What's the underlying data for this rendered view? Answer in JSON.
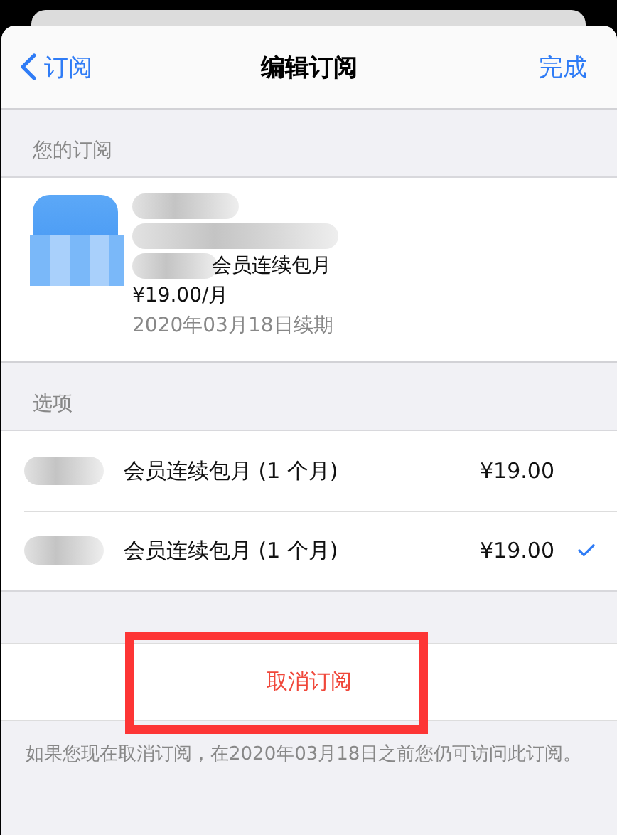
{
  "nav": {
    "back": "订阅",
    "title": "编辑订阅",
    "done": "完成"
  },
  "subscription": {
    "header": "您的订阅",
    "redacted": true,
    "plan": "会员连续包月",
    "price": "¥19.00/月",
    "renewal": "2020年03月18日续期"
  },
  "options": {
    "header": "选项",
    "items": [
      {
        "label": "会员连续包月 (1 个月)",
        "price": "¥19.00",
        "selected": false,
        "redacted": true
      },
      {
        "label": "会员连续包月 (1 个月)",
        "price": "¥19.00",
        "selected": true,
        "redacted": true
      }
    ]
  },
  "cancel": {
    "label": "取消订阅",
    "highlighted": true
  },
  "footer": "如果您现在取消订阅，在2020年03月18日之前您仍可访问此订阅。"
}
